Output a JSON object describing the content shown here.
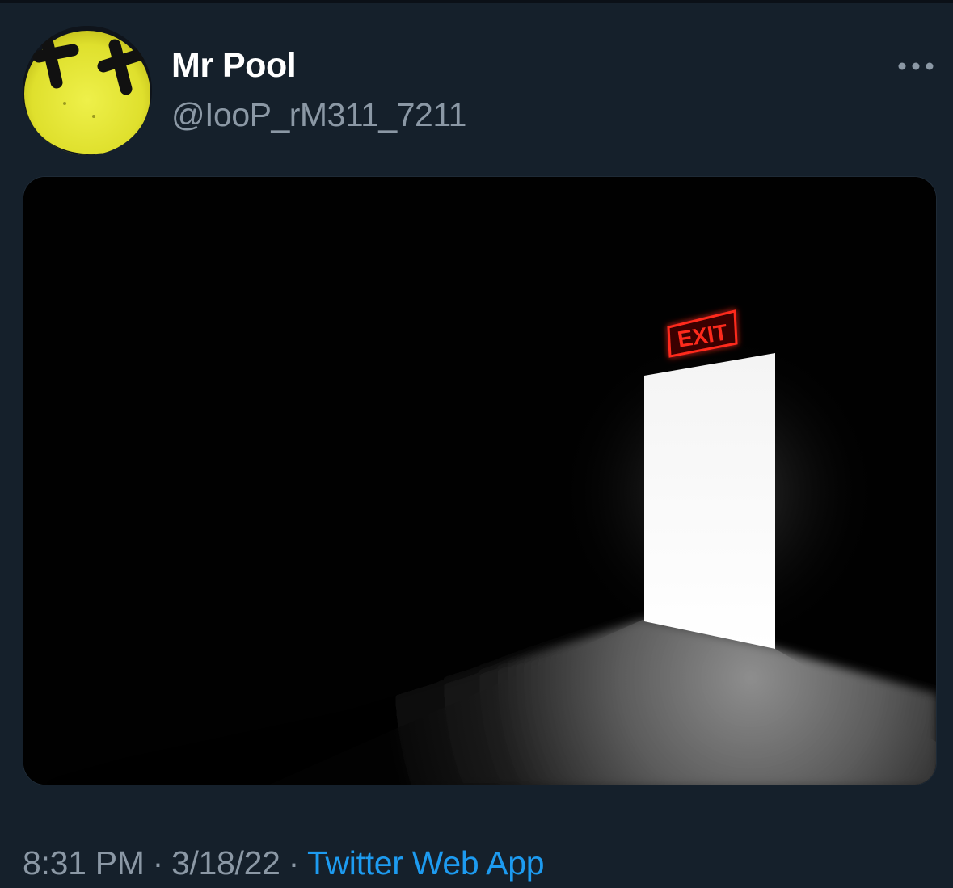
{
  "tweet": {
    "author": {
      "display_name": "Mr Pool",
      "handle": "@IooP_rM311_7211",
      "avatar_icon": "yellow-smiley-face-avatar"
    },
    "more_icon": "more-horizontal-icon",
    "media": {
      "sign_text": "EXIT"
    },
    "time": "8:31 PM",
    "date": "3/18/22",
    "separator": "·",
    "source": "Twitter Web App"
  },
  "colors": {
    "background": "#15202b",
    "display_name": "#ffffff",
    "secondary_text": "#8b98a5",
    "link": "#1d9bf0",
    "avatar_yellow": "#e4e633",
    "exit_sign_red": "#ff2a1f"
  }
}
